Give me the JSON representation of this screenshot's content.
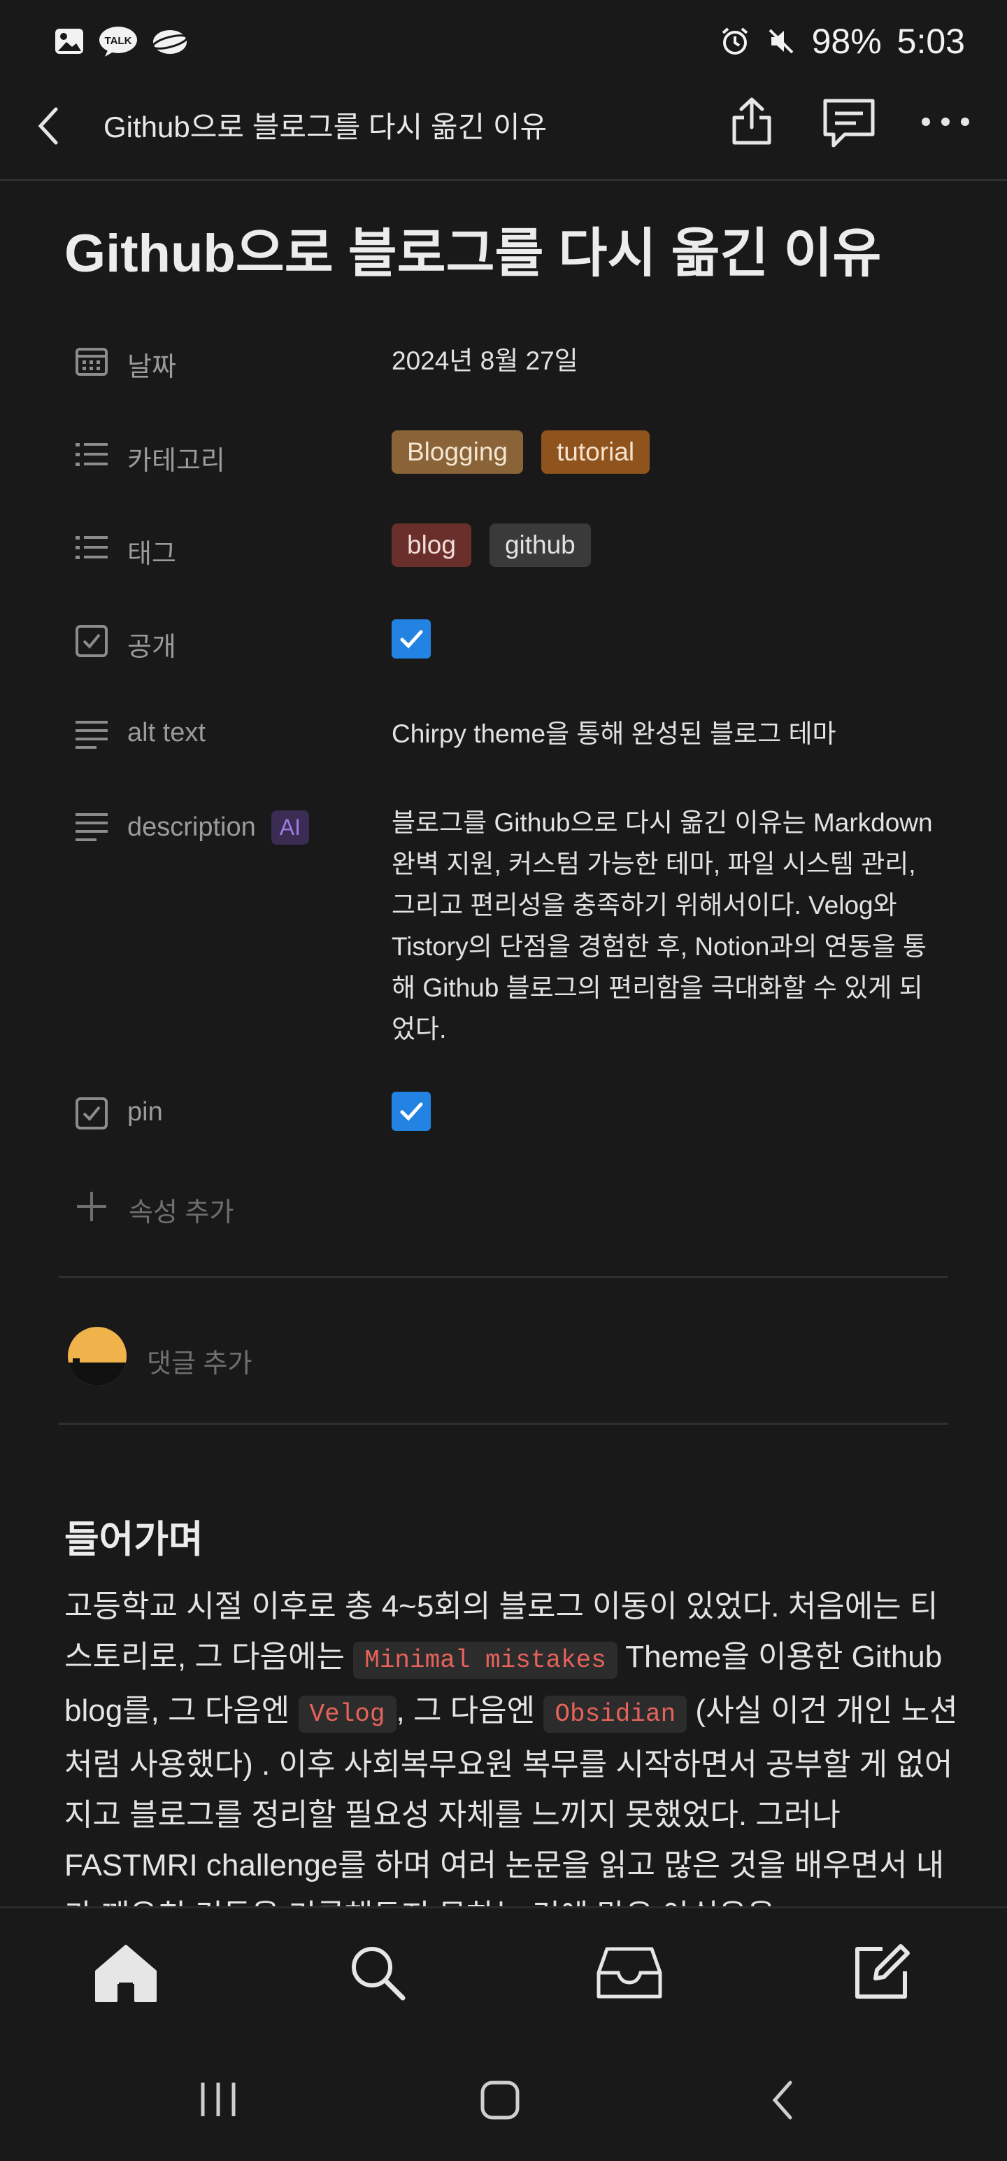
{
  "status_bar": {
    "battery": "98%",
    "time": "5:03",
    "left_icons": [
      "gallery-icon",
      "kakaotalk-icon",
      "cloud-app-icon"
    ],
    "right_icons": [
      "alarm-icon",
      "mute-icon"
    ]
  },
  "nav": {
    "title": "Github으로 블로그를 다시 옮긴 이유",
    "actions": [
      "share-icon",
      "comment-icon",
      "more-icon"
    ]
  },
  "page": {
    "title": "Github으로 블로그를 다시 옮긴 이유"
  },
  "properties": {
    "date": {
      "label": "날짜",
      "value": "2024년 8월 27일"
    },
    "category": {
      "label": "카테고리",
      "tags": [
        {
          "text": "Blogging",
          "color": "#8a6438"
        },
        {
          "text": "tutorial",
          "color": "#8f531e"
        }
      ]
    },
    "tags": {
      "label": "태그",
      "tags": [
        {
          "text": "blog",
          "color": "#6b2f2b"
        },
        {
          "text": "github",
          "color": "#3a3a3a"
        }
      ]
    },
    "public": {
      "label": "공개",
      "checked": true
    },
    "alt_text": {
      "label": "alt text",
      "value": "Chirpy theme을 통해 완성된 블로그 테마"
    },
    "description": {
      "label": "description",
      "badge": "AI",
      "value": "블로그를 Github으로 다시 옮긴 이유는 Markdown 완벽 지원, 커스텀 가능한 테마, 파일 시스템 관리, 그리고 편리성을 충족하기 위해서이다. Velog와 Tistory의 단점을 경험한 후, Notion과의 연동을 통해 Github 블로그의 편리함을 극대화할 수 있게 되었다."
    },
    "pin": {
      "label": "pin",
      "checked": true
    },
    "add_property": "속성 추가"
  },
  "comment": {
    "placeholder": "댓글 추가"
  },
  "content": {
    "heading": "들어가며",
    "p1_a": "고등학교 시절 이후로 총 4~5회의 블로그 이동이 있었다. 처음에는 티스토리로, 그 다음에는 ",
    "code1": "Minimal mistakes",
    "p1_b": " Theme을 이용한 Github blog를, 그 다음엔 ",
    "code2": "Velog",
    "p1_c": ", 그 다음엔 ",
    "code3": "Obsidian",
    "p1_d": " (사실 이건 개인 노션처럼 사용했다) . 이후 사회복무요원 복무를 시작하면서 공부할 게 없어지고 블로그를 정리할 필요성 자체를 느끼지 못했었다. 그러나 FASTMRI challenge를 하며 여러 논문을 읽고 많은 것을 배우면서 내가 깨우친 것들을 기록해두지 못하는 것에 많은 아쉬움을"
  },
  "colors": {
    "background": "#191919",
    "checkbox": "#2383e2",
    "code_text": "#e5635a"
  },
  "bottom_tabs": [
    "home-icon",
    "search-icon",
    "inbox-icon",
    "compose-icon"
  ],
  "system_nav": [
    "recent-apps-icon",
    "home-button-icon",
    "back-icon"
  ]
}
